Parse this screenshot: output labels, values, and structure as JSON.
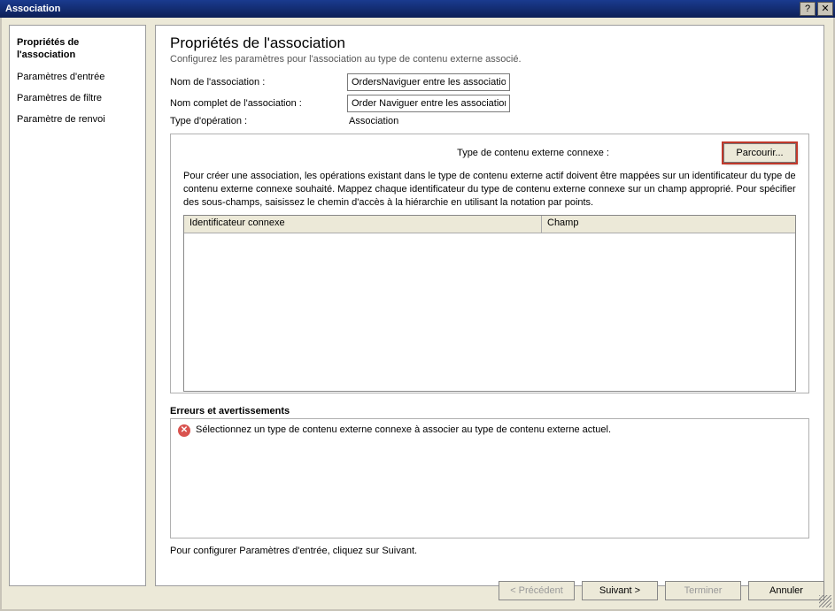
{
  "window": {
    "title": "Association",
    "help": "?",
    "close": "✕"
  },
  "nav": {
    "items": [
      {
        "label": "Propriétés de l'association",
        "selected": true
      },
      {
        "label": "Paramètres d'entrée",
        "selected": false
      },
      {
        "label": "Paramètres de filtre",
        "selected": false
      },
      {
        "label": "Paramètre de renvoi",
        "selected": false
      }
    ]
  },
  "page": {
    "heading": "Propriétés de l'association",
    "subtitle": "Configurez les paramètres pour l'association au type de contenu externe associé.",
    "name_label": "Nom de l'association :",
    "name_value": "OrdersNaviguer entre les associations",
    "fullname_label": "Nom complet de l'association :",
    "fullname_value": "Order Naviguer entre les associations",
    "optype_label": "Type d'opération :",
    "optype_value": "Association"
  },
  "panel": {
    "related_label": "Type de contenu externe connexe :",
    "browse": "Parcourir...",
    "description": "Pour créer une association, les opérations existant dans le type de contenu externe actif doivent être mappées sur un identificateur du type de contenu externe connexe souhaité. Mappez chaque identificateur du type de contenu externe connexe sur un champ approprié. Pour spécifier des sous-champs, saisissez le chemin d'accès à la hiérarchie en utilisant la notation par points.",
    "col_identifier": "Identificateur connexe",
    "col_field": "Champ"
  },
  "errors": {
    "title": "Erreurs et avertissements",
    "message": "Sélectionnez un type de contenu externe connexe à associer au type de contenu externe actuel."
  },
  "hint": "Pour configurer Paramètres d'entrée, cliquez sur Suivant.",
  "footer": {
    "back": "< Précédent",
    "next": "Suivant >",
    "finish": "Terminer",
    "cancel": "Annuler"
  }
}
